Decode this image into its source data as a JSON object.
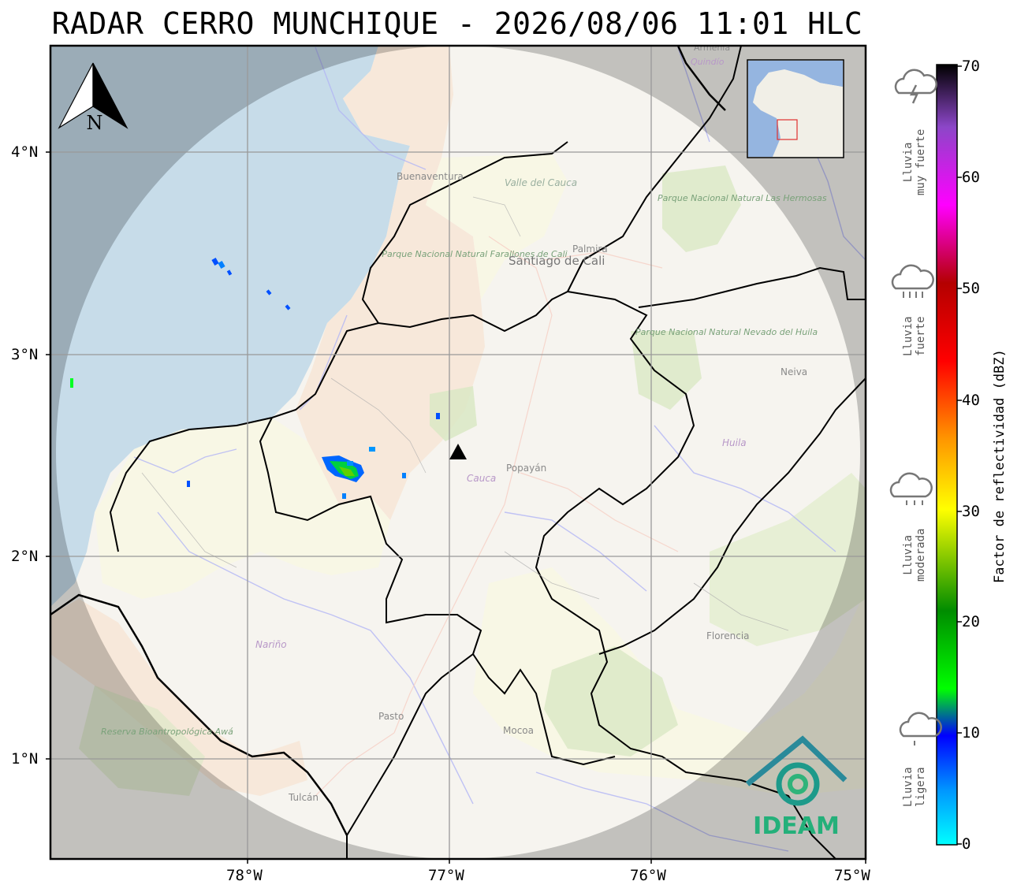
{
  "title": "RADAR CERRO MUNCHIQUE - 2026/08/06 11:01 HLC",
  "axes": {
    "lat_labels": [
      "4°N",
      "3°N",
      "2°N",
      "1°N"
    ],
    "lon_labels": [
      "78°W",
      "77°W",
      "76°W",
      "75°W"
    ]
  },
  "north_arrow": "N",
  "places": [
    {
      "name": "Buenaventura"
    },
    {
      "name": "Valle del Cauca"
    },
    {
      "name": "Palmira"
    },
    {
      "name": "Parque Nacional Natural Farallones de Cali"
    },
    {
      "name": "Santiago de Cali"
    },
    {
      "name": "Parque Nacional Natural Las Hermosas"
    },
    {
      "name": "Parque Nacional Natural Nevado del Huila"
    },
    {
      "name": "Neiva"
    },
    {
      "name": "Huila"
    },
    {
      "name": "Popayán"
    },
    {
      "name": "Cauca"
    },
    {
      "name": "Nariño"
    },
    {
      "name": "Florencia"
    },
    {
      "name": "Mocoa"
    },
    {
      "name": "Pasto"
    },
    {
      "name": "Reserva Bioantropológica Awá"
    },
    {
      "name": "Tulcán"
    },
    {
      "name": "Armenia"
    },
    {
      "name": "Quindío"
    }
  ],
  "logo": "IDEAM",
  "colorbar": {
    "title": "Factor de reflectividad (dBZ)",
    "ticks": [
      "70",
      "60",
      "50",
      "40",
      "30",
      "20",
      "10",
      "0"
    ],
    "min": 0,
    "max": 70
  },
  "categories": [
    {
      "line1": "Lluvia",
      "line2": "muy fuerte",
      "icon": "thunderstorm-icon"
    },
    {
      "line1": "Lluvia",
      "line2": "fuerte",
      "icon": "heavy-rain-icon"
    },
    {
      "line1": "Lluvia",
      "line2": "moderada",
      "icon": "moderate-rain-icon"
    },
    {
      "line1": "Lluvia",
      "line2": "ligera",
      "icon": "light-rain-icon"
    }
  ],
  "colors": {
    "ocean": "#a9c9dd",
    "outside_range": "#bfbfbf",
    "radar_disk": "#f5f5f3",
    "pacific_region": "#f3dcc6",
    "forest": "#c7dca6",
    "marker": "#000000"
  }
}
